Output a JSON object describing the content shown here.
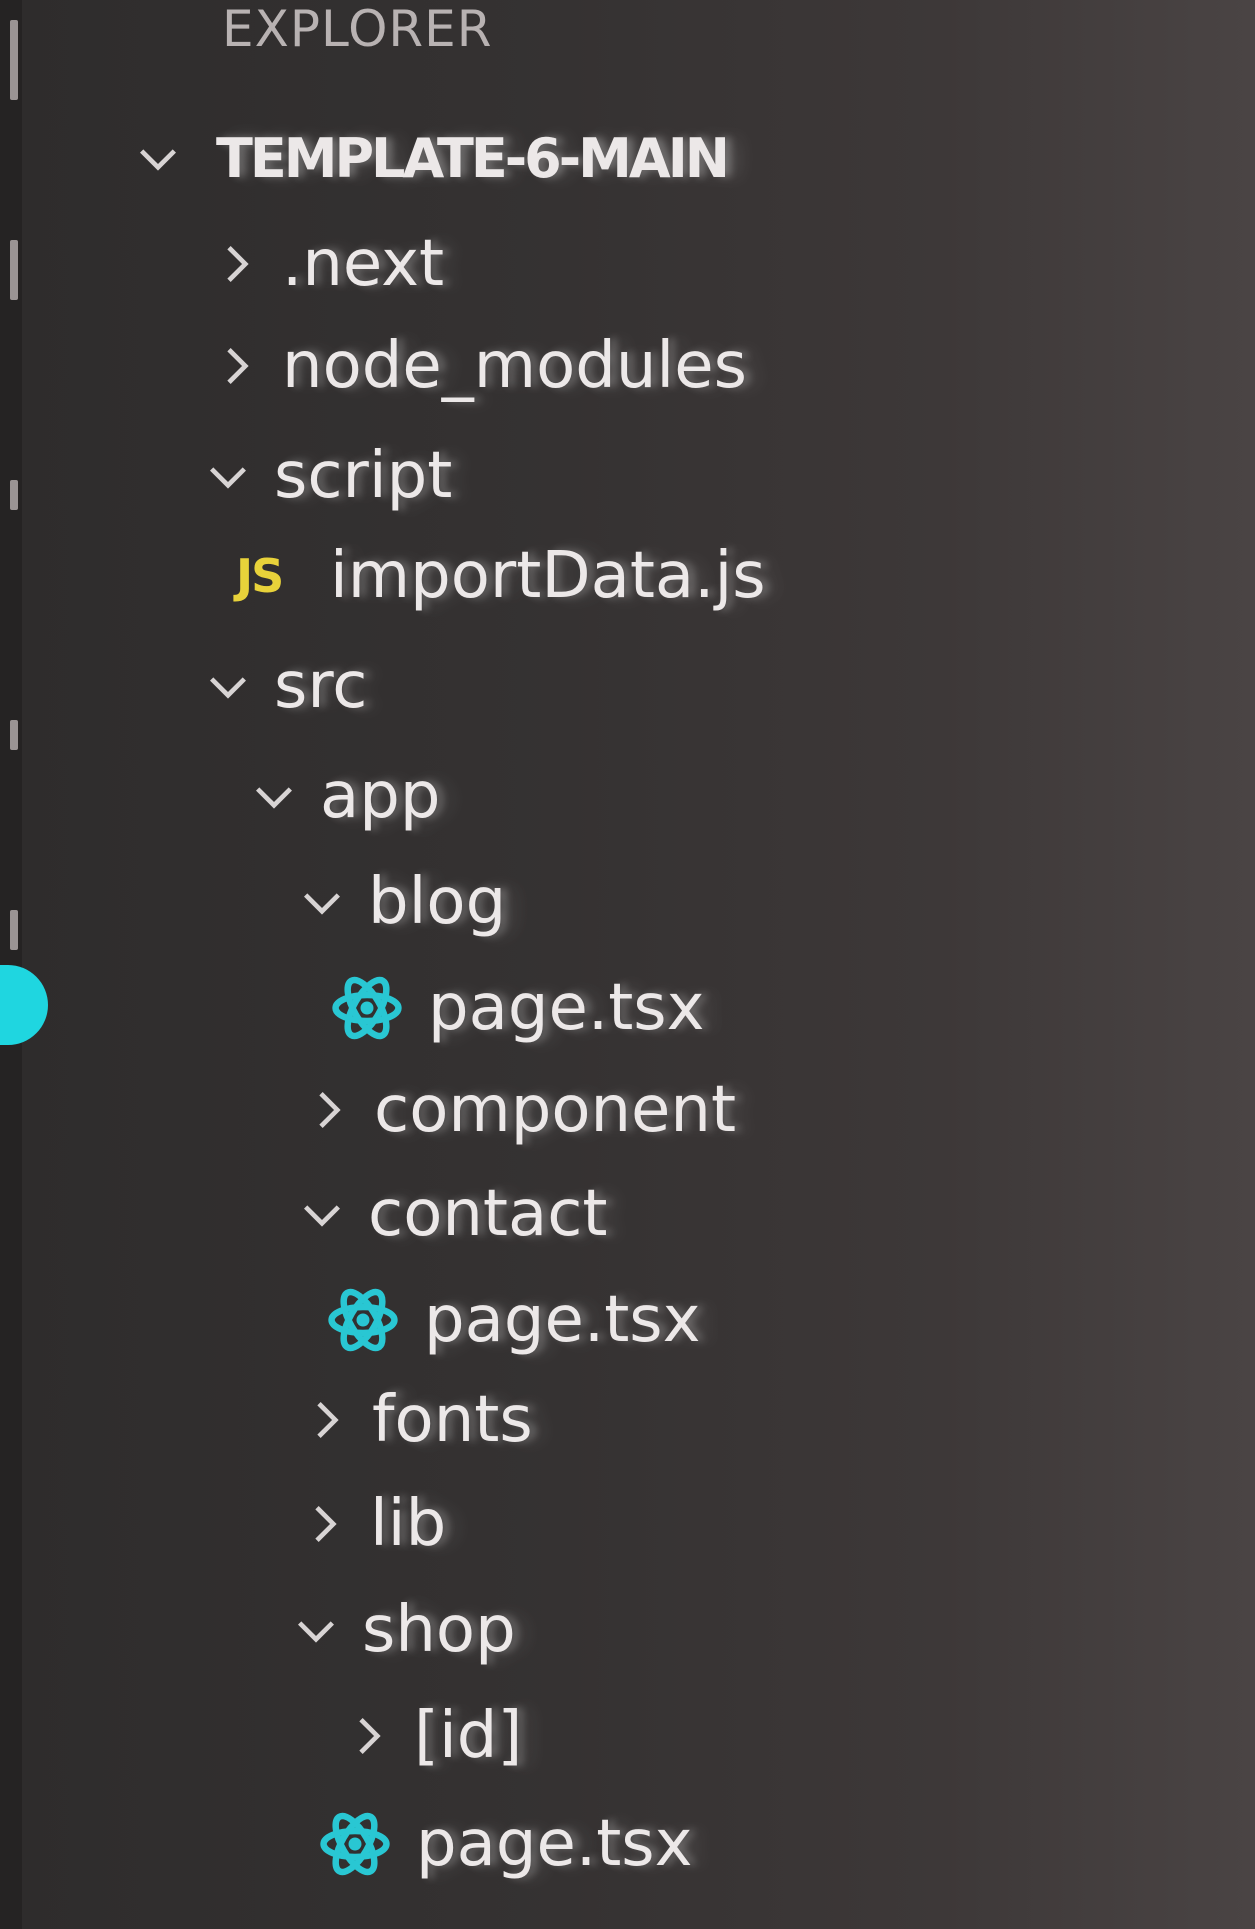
{
  "explorer": {
    "title": "EXPLORER",
    "root": {
      "label": "TEMPLATE-6-MAIN",
      "expanded": true
    },
    "items": [
      {
        "label": ".next",
        "kind": "folder",
        "expanded": false,
        "depth": 1
      },
      {
        "label": "node_modules",
        "kind": "folder",
        "expanded": false,
        "depth": 1
      },
      {
        "label": "script",
        "kind": "folder",
        "expanded": true,
        "depth": 1
      },
      {
        "label": "importData.js",
        "kind": "file",
        "icon": "js-icon",
        "icon_text": "JS",
        "depth": 2
      },
      {
        "label": "src",
        "kind": "folder",
        "expanded": true,
        "depth": 1
      },
      {
        "label": "app",
        "kind": "folder",
        "expanded": true,
        "depth": 2
      },
      {
        "label": "blog",
        "kind": "folder",
        "expanded": true,
        "depth": 3
      },
      {
        "label": "page.tsx",
        "kind": "file",
        "icon": "react-icon",
        "depth": 4
      },
      {
        "label": "component",
        "kind": "folder",
        "expanded": false,
        "depth": 3
      },
      {
        "label": "contact",
        "kind": "folder",
        "expanded": true,
        "depth": 3
      },
      {
        "label": "page.tsx",
        "kind": "file",
        "icon": "react-icon",
        "depth": 4
      },
      {
        "label": "fonts",
        "kind": "folder",
        "expanded": false,
        "depth": 3
      },
      {
        "label": "lib",
        "kind": "folder",
        "expanded": false,
        "depth": 3
      },
      {
        "label": "shop",
        "kind": "folder",
        "expanded": true,
        "depth": 3
      },
      {
        "label": "[id]",
        "kind": "folder",
        "expanded": false,
        "depth": 4
      },
      {
        "label": "page.tsx",
        "kind": "file",
        "icon": "react-icon",
        "depth": 4
      }
    ]
  },
  "colors": {
    "background": "#2e2c2c",
    "text": "#ece8e8",
    "js_icon": "#e8d23a",
    "react_icon": "#29c7d3",
    "activity_badge": "#1fd6e0"
  }
}
